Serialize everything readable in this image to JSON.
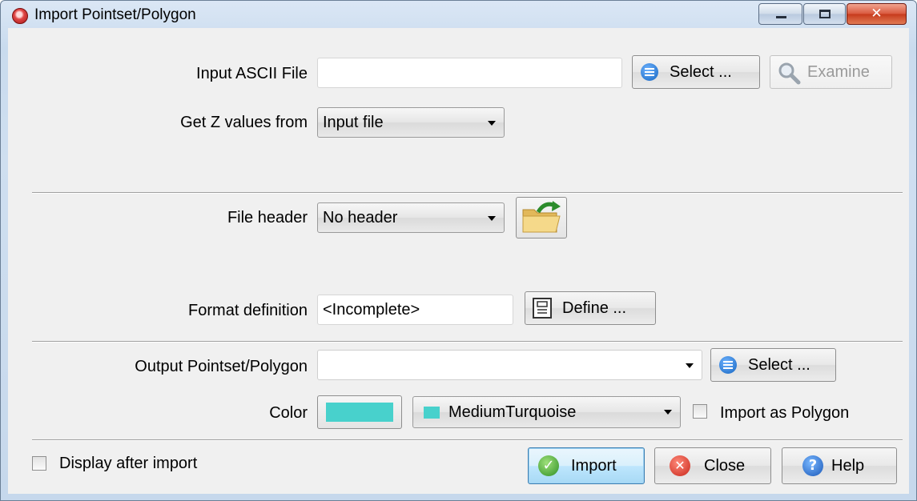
{
  "window": {
    "title": "Import Pointset/Polygon",
    "close_glyph": "✕"
  },
  "input": {
    "label": "Input ASCII File",
    "value": "",
    "select_label": "Select ...",
    "examine_label": "Examine"
  },
  "zvalues": {
    "label": "Get Z values from",
    "selected": "Input file"
  },
  "header": {
    "label": "File header",
    "selected": "No header"
  },
  "format": {
    "label": "Format definition",
    "value": "<Incomplete>",
    "define_label": "Define ..."
  },
  "output": {
    "label": "Output Pointset/Polygon",
    "value": "",
    "select_label": "Select ..."
  },
  "color": {
    "label": "Color",
    "swatch_hex": "#48d1cc",
    "selected": "MediumTurquoise",
    "polygon_label": "Import as Polygon",
    "polygon_checked": false
  },
  "footer": {
    "display_label": "Display after import",
    "display_checked": false,
    "import_label": "Import",
    "close_label": "Close",
    "help_label": "Help",
    "ok_glyph": "✓",
    "x_glyph": "✕",
    "q_glyph": "?"
  },
  "icons": {
    "app": "app-icon",
    "select": "database-icon",
    "examine": "magnifier-icon",
    "define": "document-icon",
    "header": "folder-icon"
  }
}
